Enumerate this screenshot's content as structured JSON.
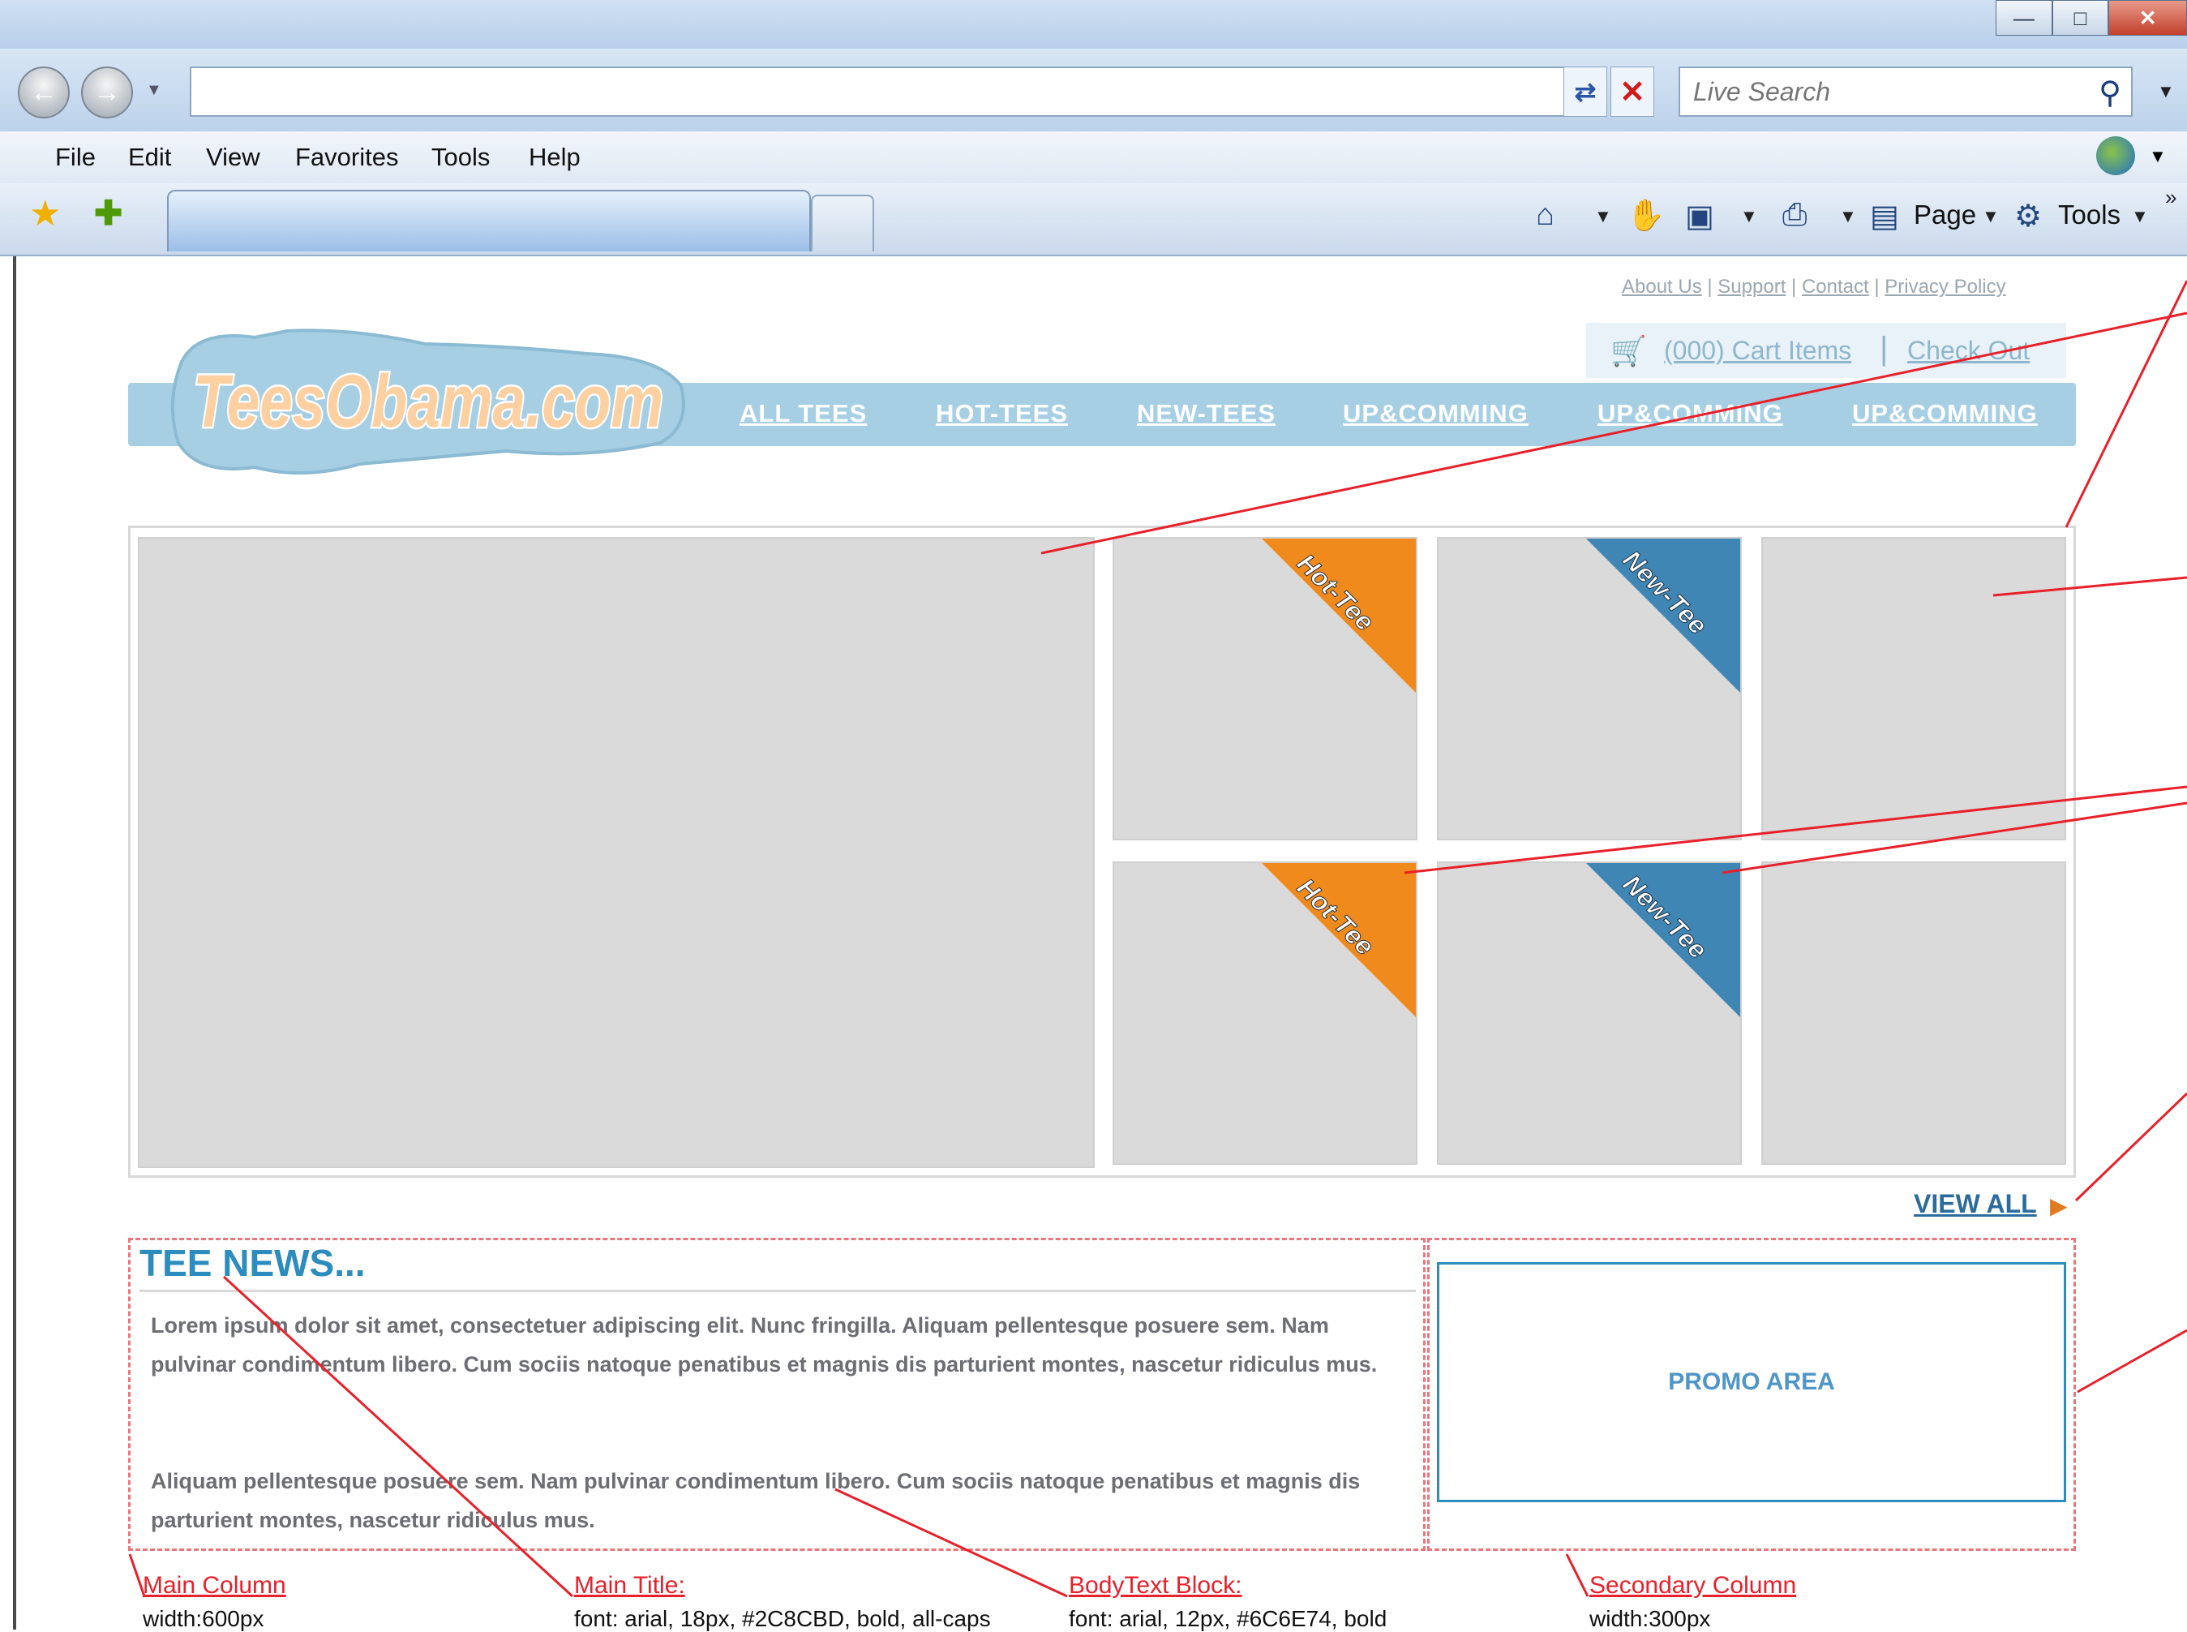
{
  "browser": {
    "search_placeholder": "Live Search",
    "menu": [
      "File",
      "Edit",
      "View",
      "Favorites",
      "Tools",
      "Help"
    ],
    "command_bar": {
      "page_label": "Page",
      "tools_label": "Tools"
    }
  },
  "site": {
    "logo_text": "TeesObama.com",
    "top_links": [
      "About Us",
      "Support",
      "Contact",
      "Privacy Policy"
    ],
    "cart": {
      "items_label": "(000) Cart Items",
      "checkout_label": "Check Out"
    },
    "nav": [
      "ALL TEES",
      "HOT-TEES",
      "NEW-TEES",
      "UP&COMMING",
      "UP&COMMING",
      "UP&COMMING"
    ],
    "ribbons": {
      "hot": "Hot-Tee",
      "new": "New-Tee"
    },
    "hot_color": "#f08a1c",
    "new_color": "#3f86b5",
    "view_all": "VIEW ALL",
    "news": {
      "title": "TEE NEWS...",
      "paragraphs": [
        "Lorem ipsum dolor sit amet, consectetuer adipiscing elit. Nunc fringilla. Aliquam pellentesque posuere sem. Nam pulvinar condimentum libero. Cum sociis natoque penatibus et magnis dis parturient montes, nascetur ridiculus mus.",
        "Aliquam pellentesque posuere sem. Nam pulvinar condimentum libero. Cum sociis natoque penatibus et magnis dis parturient montes, nascetur ridiculus mus."
      ]
    },
    "promo": "PROMO AREA"
  },
  "annotations": [
    {
      "title": "Main Column",
      "desc": "width:600px"
    },
    {
      "title": "Main Title:",
      "desc": "font: arial, 18px, #2C8CBD, bold, all-caps"
    },
    {
      "title": "BodyText Block:",
      "desc": "font: arial, 12px, #6C6E74, bold"
    },
    {
      "title": "Secondary Column",
      "desc": "width:300px"
    }
  ],
  "annotation_color": "#e8202a"
}
